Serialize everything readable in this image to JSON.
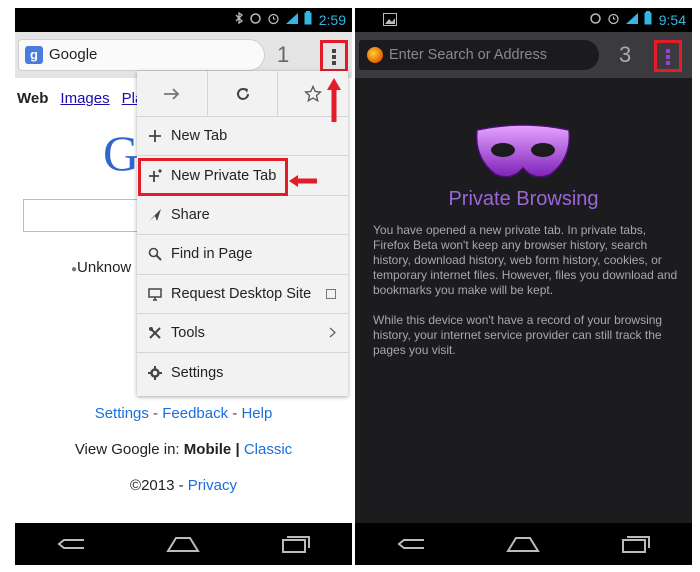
{
  "left": {
    "status_time": "2:59",
    "url_text": "Google",
    "favicon_letter": "g",
    "tab_count": "1",
    "google_tabs": [
      "Web",
      "Images",
      "Pla"
    ],
    "logo_letter": "G",
    "unknown_text": "Unknow",
    "footer": {
      "settings": "Settings",
      "sep1": " - ",
      "feedback": "Feedback",
      "sep2": " - ",
      "help": "Help"
    },
    "view_google": {
      "prefix": "View Google in: ",
      "mobile": "Mobile",
      "sep": " | ",
      "classic": "Classic"
    },
    "copyright": {
      "text": "©2013 - ",
      "privacy": "Privacy"
    },
    "menu": {
      "items": [
        {
          "label": "New Tab",
          "icon": "plus-icon"
        },
        {
          "label": "New Private Tab",
          "icon": "private-plus-icon"
        },
        {
          "label": "Share",
          "icon": "share-icon"
        },
        {
          "label": "Find in Page",
          "icon": "search-icon"
        },
        {
          "label": "Request Desktop Site",
          "icon": "desktop-icon"
        },
        {
          "label": "Tools",
          "icon": "tools-icon"
        },
        {
          "label": "Settings",
          "icon": "gear-icon"
        }
      ]
    }
  },
  "right": {
    "status_time": "9:54",
    "url_placeholder": "Enter Search or Address",
    "tab_count": "3",
    "title": "Private Browsing",
    "para1": "You have opened a new private tab. In private tabs, Firefox Beta won't keep any browser history, search history, download history, web form history, cookies, or temporary internet files. However, files you download and bookmarks you make will be kept.",
    "para2": "While this device won't have a record of your browsing history, your internet service provider can still track the pages you visit."
  },
  "colors": {
    "highlight": "#e31c2a",
    "private_purple": "#9b66d6",
    "link_blue": "#1a6ee0"
  }
}
